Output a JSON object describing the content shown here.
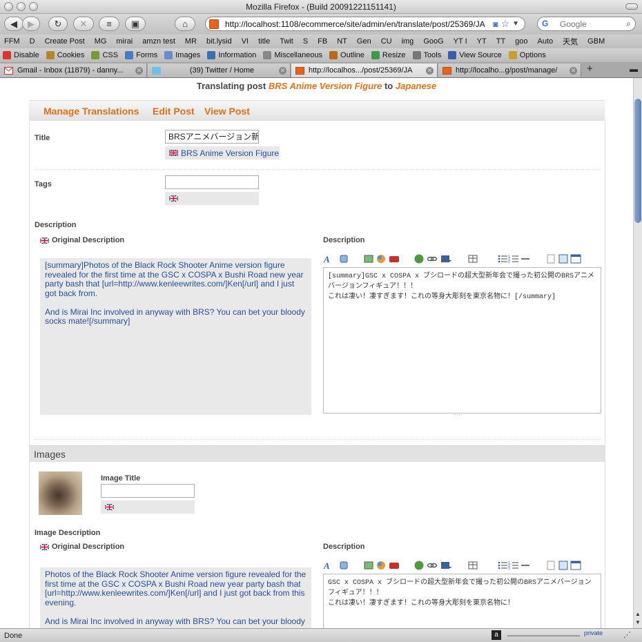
{
  "window": {
    "title": "Mozilla Firefox - (Build 20091221151141)"
  },
  "nav": {
    "url": "http://localhost:1108/ecommerce/site/admin/en/translate/post/25369/JA",
    "search_placeholder": "Google"
  },
  "bookmarks": [
    "FFM",
    "D",
    "Create Post",
    "MG",
    "mirai",
    "amzn test",
    "MR",
    "bit.lysid",
    "VI",
    "title",
    "Twit",
    "S",
    "FB",
    "NT",
    "Gen",
    "CU",
    "img",
    "GooG",
    "YT I",
    "YT",
    "TT",
    "goo",
    "Auto",
    "天気",
    "GBM"
  ],
  "devbar": {
    "items": [
      "Disable",
      "Cookies",
      "CSS",
      "Forms",
      "Images",
      "Information",
      "Miscellaneous",
      "Outline",
      "Resize",
      "Tools",
      "View Source",
      "Options"
    ]
  },
  "tabs": [
    {
      "label": "Gmail - Inbox (11879) - danny..."
    },
    {
      "label": "(39) Twitter / Home"
    },
    {
      "label": "http://localhos.../post/25369/JA"
    },
    {
      "label": "http://localho...g/post/manage/"
    }
  ],
  "page": {
    "heading_prefix": "Translating post",
    "post_name": "BRS Anime Version Figure",
    "heading_mid": "to",
    "language": "Japanese",
    "actions": [
      "Manage Translations",
      "Edit Post",
      "View Post"
    ],
    "title_label": "Title",
    "title_value": "BRSアニメバージョン新作",
    "title_original": "BRS Anime Version Figure",
    "tags_label": "Tags",
    "tags_value": "",
    "description_section": "Description",
    "original_description_label": "Original Description",
    "description_label": "Description",
    "original_description": [
      "[summary]Photos of the Black Rock Shooter Anime version figure revealed for the first time at the GSC x COSPA x Bushi Road new year party bash that [url=http://www.kenleewrites.com/]Ken[/url] and I just got back from.",
      "And is Mirai Inc involved in anyway with BRS? You can bet your bloody socks mate![/summary]"
    ],
    "translated_description": [
      "[summary]GSC x COSPA x ブシロードの超大型新年会で撮った初公開のBRSアニメバージョンフィギュア！！！",
      "これは凄い！凄すぎます！これの等身大彫刻を東京名物に！[/summary]"
    ],
    "images_section": "Images",
    "image_title_label": "Image Title",
    "image_title_value": "",
    "image_description_label": "Image Description",
    "image_original_description": [
      "Photos of the Black Rock Shooter Anime version figure revealed for the first time at the GSC x COSPA x Bushi Road new year party bash that [url=http://www.kenleewrites.com/]Ken[/url] and I just got back from this evening.",
      "And is Mirai Inc involved in anyway with BRS? You can bet your bloody"
    ],
    "image_translated_description": [
      "GSC x COSPA x ブシロードの超大型新年会で撮った初公開のBRSアニメバージョンフィギュア！！！",
      "これは凄い！凄すぎます！これの等身大彫刻を東京名物に！"
    ]
  },
  "status": {
    "text": "Done",
    "private": "private"
  },
  "colors": {
    "accent": "#e67015",
    "link": "#244f9e",
    "thumb_shade": "#46372b"
  }
}
